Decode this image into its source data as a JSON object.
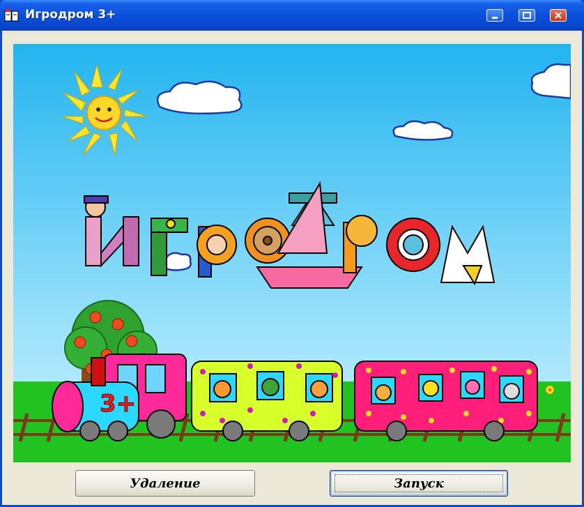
{
  "window": {
    "title": "Игродром 3+",
    "icon": "app-books-icon",
    "controls": [
      "minimize-icon",
      "maximize-icon",
      "close-icon"
    ]
  },
  "splash": {
    "logo_text": "ИГРОДРОМ",
    "train_badge": "3+"
  },
  "buttons": {
    "delete_label": "Удаление",
    "launch_label": "Запуск"
  },
  "colors": {
    "titlebar": "#0a4fdc",
    "sky_top": "#22b4ef",
    "sky_bottom": "#c9f0fd",
    "grass": "#20c31f",
    "client_bg": "#ece9d8"
  }
}
